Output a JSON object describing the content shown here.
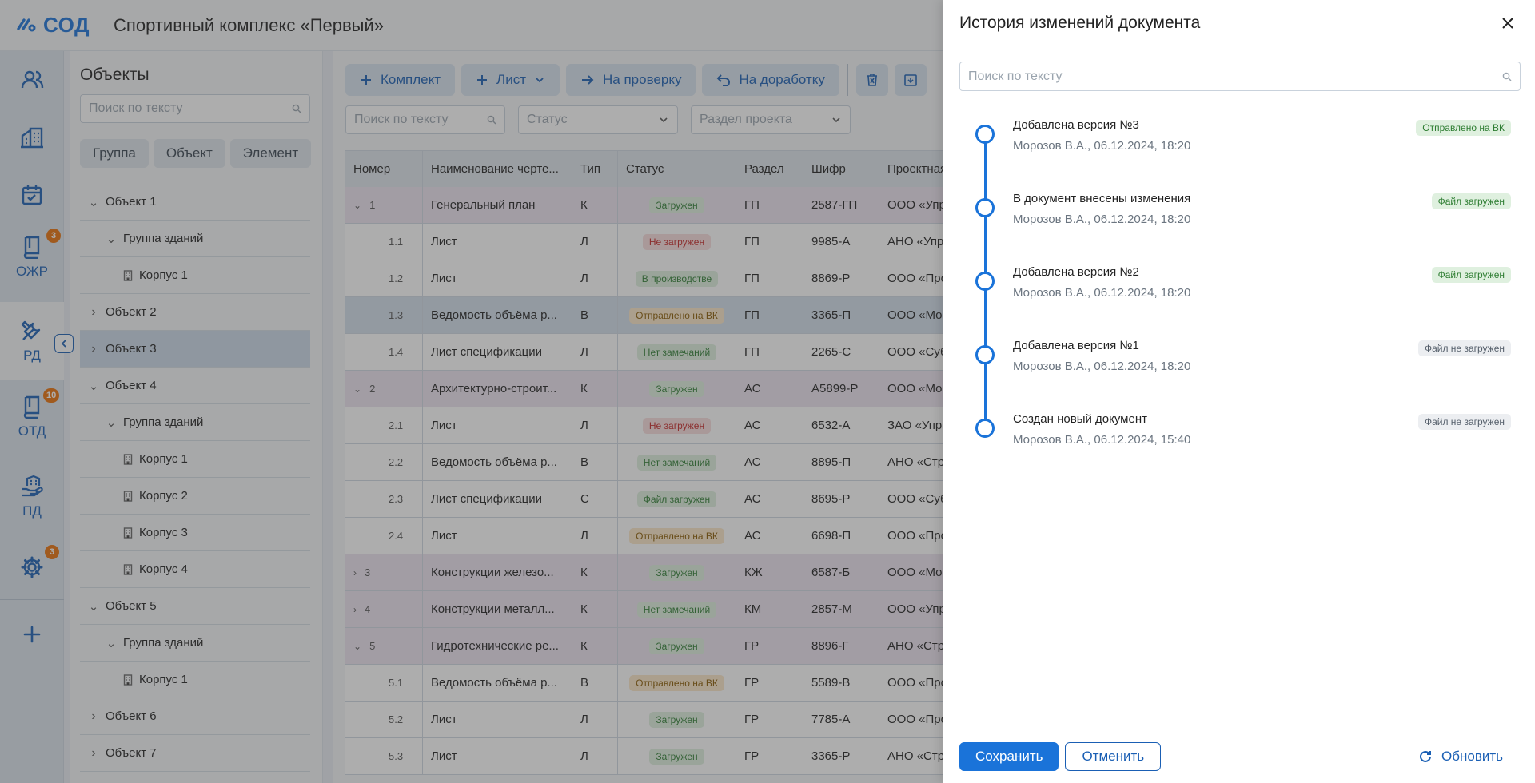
{
  "header": {
    "logo_text": "СОД",
    "project_title": "Спортивный комплекс «Первый»"
  },
  "rail": {
    "items": [
      {
        "name": "users",
        "label": "",
        "badge": ""
      },
      {
        "name": "buildings",
        "label": "",
        "badge": ""
      },
      {
        "name": "tasks",
        "label": "",
        "badge": ""
      },
      {
        "name": "ozhr",
        "label": "ОЖР",
        "badge": "3"
      },
      {
        "name": "rd",
        "label": "РД",
        "badge": ""
      },
      {
        "name": "otd",
        "label": "ОТД",
        "badge": "10"
      },
      {
        "name": "pd",
        "label": "ПД",
        "badge": ""
      },
      {
        "name": "settings",
        "label": "",
        "badge": "3"
      }
    ]
  },
  "objects_panel": {
    "title": "Объекты",
    "search_placeholder": "Поиск по тексту",
    "segments": [
      "Группа",
      "Объект",
      "Элемент"
    ],
    "tree": [
      {
        "label": "Объект 1",
        "level": 0,
        "chev": "down"
      },
      {
        "label": "Группа зданий",
        "level": 1,
        "chev": "down"
      },
      {
        "label": "Корпус 1",
        "level": 2,
        "chev": ""
      },
      {
        "label": "Объект 2",
        "level": 0,
        "chev": "right"
      },
      {
        "label": "Объект 3",
        "level": 0,
        "chev": "right",
        "selected": true
      },
      {
        "label": "Объект 4",
        "level": 0,
        "chev": "down"
      },
      {
        "label": "Группа зданий",
        "level": 1,
        "chev": "down"
      },
      {
        "label": "Корпус 1",
        "level": 2,
        "chev": ""
      },
      {
        "label": "Корпус 2",
        "level": 2,
        "chev": ""
      },
      {
        "label": "Корпус 3",
        "level": 2,
        "chev": ""
      },
      {
        "label": "Корпус 4",
        "level": 2,
        "chev": ""
      },
      {
        "label": "Объект 5",
        "level": 0,
        "chev": "down"
      },
      {
        "label": "Группа зданий",
        "level": 1,
        "chev": "down"
      },
      {
        "label": "Корпус 1",
        "level": 2,
        "chev": ""
      },
      {
        "label": "Объект 6",
        "level": 0,
        "chev": "right"
      },
      {
        "label": "Объект 7",
        "level": 0,
        "chev": "right"
      }
    ]
  },
  "toolbar": {
    "set_label": "Комплект",
    "sheet_label": "Лист",
    "review_label": "На проверку",
    "rework_label": "На доработку"
  },
  "filters": {
    "search_placeholder": "Поиск по тексту",
    "status_placeholder": "Статус",
    "section_placeholder": "Раздел проекта"
  },
  "table": {
    "columns": [
      "Номер",
      "Наименование черте...",
      "Тип",
      "Статус",
      "Раздел",
      "Шифр",
      "Проектная"
    ],
    "rows": [
      {
        "num": "1",
        "group": true,
        "chev": "down",
        "name": "Генеральный план",
        "type": "К",
        "status": "Загружен",
        "status_kind": "ok",
        "section": "ГП",
        "code": "2587-ГП",
        "org": "ООО «Упра"
      },
      {
        "num": "1.1",
        "name": "Лист",
        "type": "Л",
        "status": "Не загружен",
        "status_kind": "err",
        "section": "ГП",
        "code": "9985-А",
        "org": "АНО «Упра"
      },
      {
        "num": "1.2",
        "name": "Лист",
        "type": "Л",
        "status": "В производстве",
        "status_kind": "ok",
        "section": "ГП",
        "code": "8869-Р",
        "org": "ООО «Про"
      },
      {
        "num": "1.3",
        "name": "Ведомость объёма р...",
        "type": "В",
        "status": "Отправлено на ВК",
        "status_kind": "warn",
        "section": "ГП",
        "code": "3365-П",
        "org": "ООО «Мос",
        "highlight": true
      },
      {
        "num": "1.4",
        "name": "Лист спецификации",
        "type": "Л",
        "status": "Нет замечаний",
        "status_kind": "ok",
        "section": "ГП",
        "code": "2265-С",
        "org": "ООО «Суб"
      },
      {
        "num": "2",
        "group": true,
        "chev": "down",
        "name": "Архитектурно-строит...",
        "type": "К",
        "status": "Загружен",
        "status_kind": "ok",
        "section": "АС",
        "code": "А5899-Р",
        "org": "ООО «Мос"
      },
      {
        "num": "2.1",
        "name": "Лист",
        "type": "Л",
        "status": "Не загружен",
        "status_kind": "err",
        "section": "АС",
        "code": "6532-А",
        "org": "ЗАО «Упра"
      },
      {
        "num": "2.2",
        "name": "Ведомость объёма р...",
        "type": "В",
        "status": "Нет замечаний",
        "status_kind": "ok",
        "section": "АС",
        "code": "8895-П",
        "org": "АНО «Стр"
      },
      {
        "num": "2.3",
        "name": "Лист спецификации",
        "type": "С",
        "status": "Файл загружен",
        "status_kind": "ok",
        "section": "АС",
        "code": "8695-Р",
        "org": "ООО «Суб"
      },
      {
        "num": "2.4",
        "name": "Лист",
        "type": "Л",
        "status": "Отправлено на ВК",
        "status_kind": "warn",
        "section": "АС",
        "code": "6698-П",
        "org": "ООО «Про"
      },
      {
        "num": "3",
        "group": true,
        "chev": "right",
        "name": "Конструкции железо...",
        "type": "К",
        "status": "Загружен",
        "status_kind": "ok",
        "section": "КЖ",
        "code": "6587-Б",
        "org": "ООО «Мос"
      },
      {
        "num": "4",
        "group": true,
        "chev": "right",
        "name": "Конструкции металл...",
        "type": "К",
        "status": "Нет замечаний",
        "status_kind": "ok",
        "section": "КМ",
        "code": "2857-М",
        "org": "ООО «Упра"
      },
      {
        "num": "5",
        "group": true,
        "chev": "down",
        "name": "Гидротехнические ре...",
        "type": "К",
        "status": "Загружен",
        "status_kind": "ok",
        "section": "ГР",
        "code": "8896-Г",
        "org": "АНО «Стр"
      },
      {
        "num": "5.1",
        "name": "Ведомость объёма р...",
        "type": "В",
        "status": "Отправлено на ВК",
        "status_kind": "warn",
        "section": "ГР",
        "code": "5589-В",
        "org": "ООО «Про"
      },
      {
        "num": "5.2",
        "name": "Лист",
        "type": "Л",
        "status": "Загружен",
        "status_kind": "ok",
        "section": "ГР",
        "code": "7785-А",
        "org": "ООО «Про"
      },
      {
        "num": "5.3",
        "name": "Лист",
        "type": "Л",
        "status": "Загружен",
        "status_kind": "ok",
        "section": "ГР",
        "code": "3365-Р",
        "org": "АНО «Стр"
      }
    ]
  },
  "drawer": {
    "title": "История изменений документа",
    "search_placeholder": "Поиск по тексту",
    "history": [
      {
        "title": "Добавлена версия №3",
        "meta": "Морозов В.А., 06.12.2024, 18:20",
        "badge": "Отправлено на ВК",
        "badge_kind": "ok"
      },
      {
        "title": "В документ внесены изменения",
        "meta": "Морозов В.А., 06.12.2024, 18:20",
        "badge": "Файл загружен",
        "badge_kind": "ok"
      },
      {
        "title": "Добавлена версия №2",
        "meta": "Морозов В.А., 06.12.2024, 18:20",
        "badge": "Файл загружен",
        "badge_kind": "ok"
      },
      {
        "title": "Добавлена версия №1",
        "meta": "Морозов В.А., 06.12.2024, 18:20",
        "badge": "Файл не загружен",
        "badge_kind": "neutral"
      },
      {
        "title": "Создан новый документ",
        "meta": "Морозов В.А., 06.12.2024, 15:40",
        "badge": "Файл не загружен",
        "badge_kind": "neutral"
      }
    ],
    "save_label": "Сохранить",
    "cancel_label": "Отменить",
    "refresh_label": "Обновить"
  },
  "colors": {
    "accent": "#1a73d9",
    "status_ok_bg": "#dff0df",
    "status_ok_fg": "#2e7d32",
    "status_err_bg": "#f8dcdc",
    "status_err_fg": "#c62828",
    "status_warn_bg": "#fbe7c8",
    "status_warn_fg": "#8a5a00",
    "status_neutral_bg": "#eceef1",
    "status_neutral_fg": "#555f6b"
  }
}
